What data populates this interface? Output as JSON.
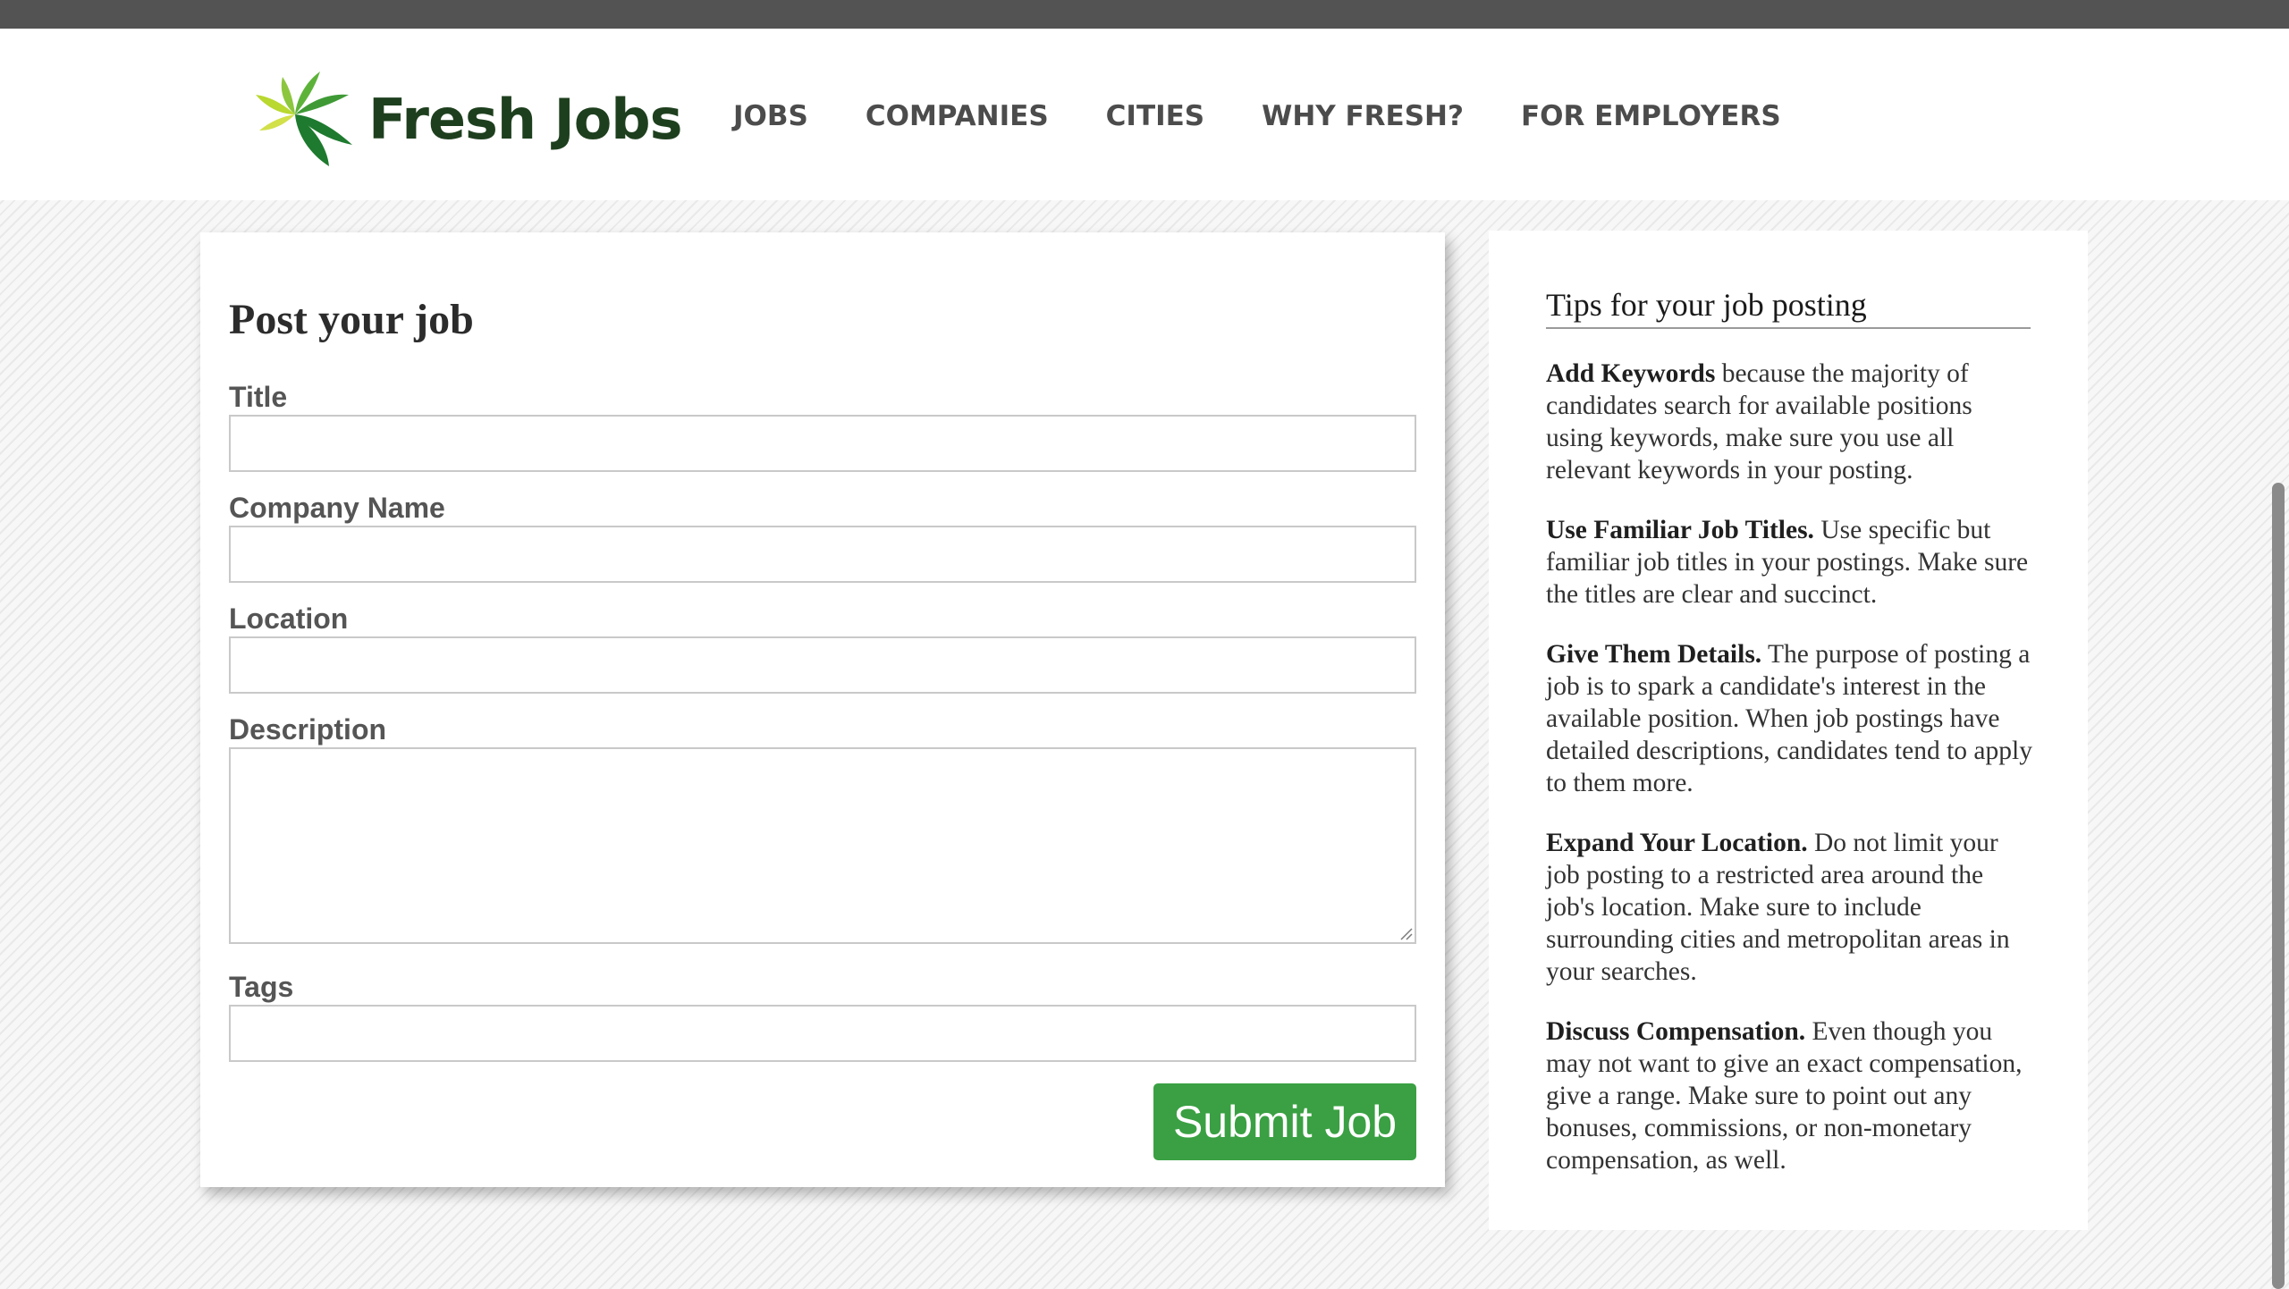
{
  "brand": {
    "name": "Fresh Jobs",
    "logo_icon": "leaf-burst-icon",
    "colors": {
      "logo_dark_green": "#1e7a2e",
      "logo_mid_green": "#5db33a",
      "logo_light_green": "#b9d830",
      "logo_text": "#1e3f1e"
    }
  },
  "nav": {
    "items": [
      {
        "label": "JOBS"
      },
      {
        "label": "COMPANIES"
      },
      {
        "label": "CITIES"
      },
      {
        "label": "WHY FRESH?"
      },
      {
        "label": "FOR EMPLOYERS"
      }
    ]
  },
  "form": {
    "title": "Post your job",
    "fields": {
      "title": {
        "label": "Title",
        "value": "",
        "placeholder": ""
      },
      "company_name": {
        "label": "Company Name",
        "value": "",
        "placeholder": ""
      },
      "location": {
        "label": "Location",
        "value": "",
        "placeholder": ""
      },
      "description": {
        "label": "Description",
        "value": "",
        "placeholder": ""
      },
      "tags": {
        "label": "Tags",
        "value": "",
        "placeholder": ""
      }
    },
    "submit_label": "Submit Job",
    "submit_color": "#3aa043"
  },
  "tips": {
    "title": "Tips for your job posting",
    "items": [
      {
        "heading": "Add Keywords",
        "body": " because the majority of candidates search for available positions using keywords, make sure you use all relevant keywords in your posting."
      },
      {
        "heading": "Use Familiar Job Titles.",
        "body": " Use specific but familiar job titles in your postings. Make sure the titles are clear and succinct."
      },
      {
        "heading": "Give Them Details.",
        "body": " The purpose of posting a job is to spark a candidate's interest in the available position. When job postings have detailed descriptions, candidates tend to apply to them more."
      },
      {
        "heading": "Expand Your Location.",
        "body": " Do not limit your job posting to a restricted area around the job's location. Make sure to include surrounding cities and metropolitan areas in your searches."
      },
      {
        "heading": "Discuss Compensation.",
        "body": " Even though you may not want to give an exact compensation, give a range. Make sure to point out any bonuses, commissions, or non-monetary compensation, as well."
      }
    ]
  }
}
